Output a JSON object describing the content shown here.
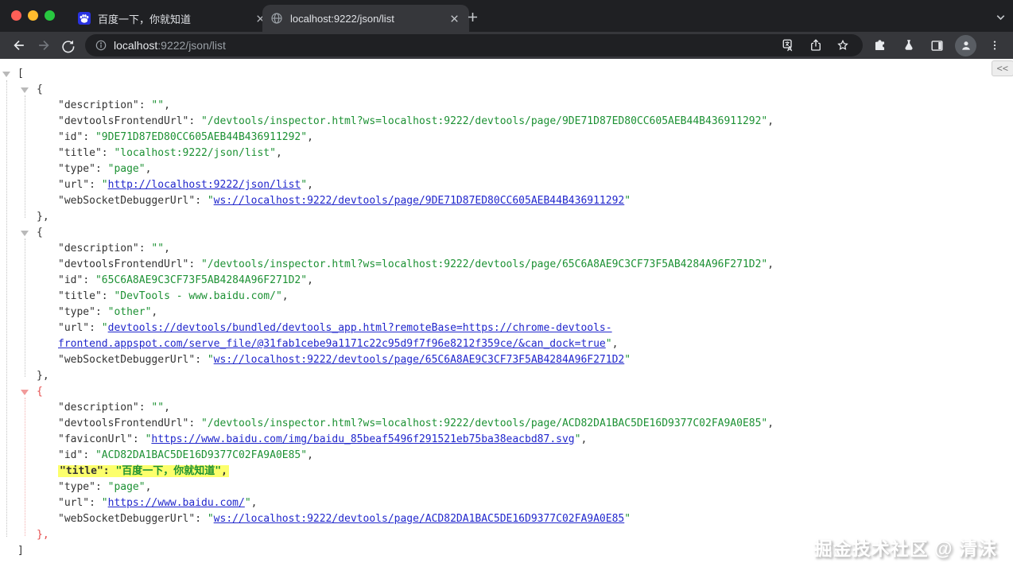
{
  "colors": {
    "string_green": "#1d9134",
    "link_blue": "#2127cc",
    "selected_red": "#e54d4d",
    "highlight_yellow": "#fcff6c",
    "frame_dark": "#1f2023",
    "toolbar_dark": "#36373b"
  },
  "browser": {
    "tabs": [
      {
        "title": "百度一下，你就知道",
        "favicon": "baidu-paw-icon",
        "active": false
      },
      {
        "title": "localhost:9222/json/list",
        "favicon": "globe-icon",
        "active": true
      }
    ],
    "address_bar": {
      "host": "localhost",
      "path": ":9222/json/list"
    }
  },
  "page": {
    "collapse_label": "<<",
    "watermark": "掘金技术社区 @ 清沫"
  },
  "json_tree": {
    "root_open": "[",
    "root_close": "]",
    "objects": [
      {
        "accent": "normal",
        "open": "{",
        "close": "},",
        "rows": [
          {
            "key": "description",
            "vtype": "string",
            "value": "",
            "comma": true
          },
          {
            "key": "devtoolsFrontendUrl",
            "vtype": "string",
            "value": "/devtools/inspector.html?ws=localhost:9222/devtools/page/9DE71D87ED80CC605AEB44B436911292",
            "comma": true
          },
          {
            "key": "id",
            "vtype": "string",
            "value": "9DE71D87ED80CC605AEB44B436911292",
            "comma": true
          },
          {
            "key": "title",
            "vtype": "string",
            "value": "localhost:9222/json/list",
            "comma": true
          },
          {
            "key": "type",
            "vtype": "string",
            "value": "page",
            "comma": true
          },
          {
            "key": "url",
            "vtype": "link",
            "value": "http://localhost:9222/json/list",
            "comma": true
          },
          {
            "key": "webSocketDebuggerUrl",
            "vtype": "link",
            "value": "ws://localhost:9222/devtools/page/9DE71D87ED80CC605AEB44B436911292",
            "comma": false
          }
        ]
      },
      {
        "accent": "normal",
        "open": "{",
        "close": "},",
        "rows": [
          {
            "key": "description",
            "vtype": "string",
            "value": "",
            "comma": true
          },
          {
            "key": "devtoolsFrontendUrl",
            "vtype": "string",
            "value": "/devtools/inspector.html?ws=localhost:9222/devtools/page/65C6A8AE9C3CF73F5AB4284A96F271D2",
            "comma": true
          },
          {
            "key": "id",
            "vtype": "string",
            "value": "65C6A8AE9C3CF73F5AB4284A96F271D2",
            "comma": true
          },
          {
            "key": "title",
            "vtype": "string",
            "value": "DevTools - www.baidu.com/",
            "comma": true
          },
          {
            "key": "type",
            "vtype": "string",
            "value": "other",
            "comma": true
          },
          {
            "key": "url",
            "vtype": "link",
            "value": [
              "devtools://devtools/bundled/devtools_app.html?remoteBase=https://chrome-devtools-",
              "frontend.appspot.com/serve_file/@31fab1cebe9a1171c22c95d9f7f96e8212f359ce/&can_dock=true"
            ],
            "comma": true
          },
          {
            "key": "webSocketDebuggerUrl",
            "vtype": "link",
            "value": "ws://localhost:9222/devtools/page/65C6A8AE9C3CF73F5AB4284A96F271D2",
            "comma": false
          }
        ]
      },
      {
        "accent": "red",
        "open": "{",
        "close": "},",
        "rows": [
          {
            "key": "description",
            "vtype": "string",
            "value": "",
            "comma": true
          },
          {
            "key": "devtoolsFrontendUrl",
            "vtype": "string",
            "value": "/devtools/inspector.html?ws=localhost:9222/devtools/page/ACD82DA1BAC5DE16D9377C02FA9A0E85",
            "comma": true
          },
          {
            "key": "faviconUrl",
            "vtype": "link",
            "value": "https://www.baidu.com/img/baidu_85beaf5496f291521eb75ba38eacbd87.svg",
            "comma": true
          },
          {
            "key": "id",
            "vtype": "string",
            "value": "ACD82DA1BAC5DE16D9377C02FA9A0E85",
            "comma": true
          },
          {
            "key": "title",
            "vtype": "string",
            "value": "百度一下，你就知道",
            "comma": true,
            "highlight": true
          },
          {
            "key": "type",
            "vtype": "string",
            "value": "page",
            "comma": true
          },
          {
            "key": "url",
            "vtype": "link",
            "value": "https://www.baidu.com/",
            "comma": true
          },
          {
            "key": "webSocketDebuggerUrl",
            "vtype": "link",
            "value": "ws://localhost:9222/devtools/page/ACD82DA1BAC5DE16D9377C02FA9A0E85",
            "comma": false
          }
        ]
      }
    ]
  }
}
